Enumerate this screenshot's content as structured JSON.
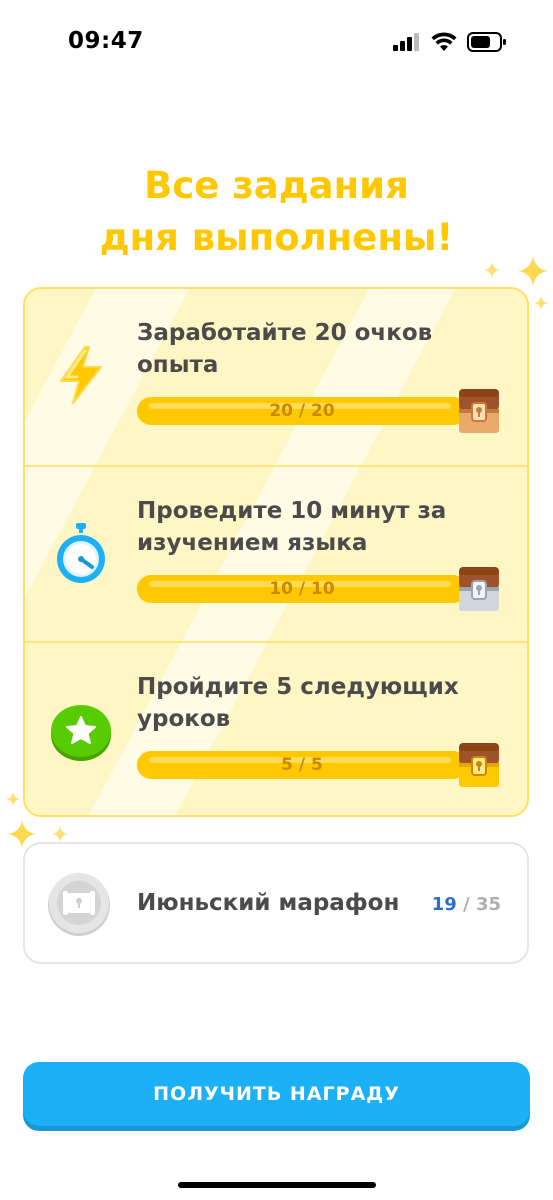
{
  "status_bar": {
    "time": "09:47",
    "icons": [
      "signal-icon",
      "wifi-icon",
      "battery-icon"
    ]
  },
  "headline": {
    "line1": "Все задания",
    "line2": "дня выполнены!"
  },
  "colors": {
    "accent_yellow": "#FFC800",
    "card_bg": "#FFF6C6",
    "text_dark": "#4B4B4B",
    "button_blue": "#1CB0F6",
    "progress_text": "#C98A00"
  },
  "quests": [
    {
      "icon": "lightning-icon",
      "title": "Заработайте 20 очков опыта",
      "progress_text": "20 / 20",
      "progress": 1.0,
      "chest": "bronze-chest-icon"
    },
    {
      "icon": "stopwatch-icon",
      "title": "Проведите 10 минут за изучением языка",
      "progress_text": "10 / 10",
      "progress": 1.0,
      "chest": "silver-chest-icon"
    },
    {
      "icon": "star-badge-icon",
      "title": "Пройдите 5 следующих уроков",
      "progress_text": "5 / 5",
      "progress": 1.0,
      "chest": "gold-chest-icon"
    }
  ],
  "marathon": {
    "title": "Июньский марафон",
    "current": "19",
    "separator": " / ",
    "total": "35",
    "badge_icon": "marathon-badge-icon"
  },
  "claim_button": {
    "label": "ПОЛУЧИТЬ НАГРАДУ"
  }
}
